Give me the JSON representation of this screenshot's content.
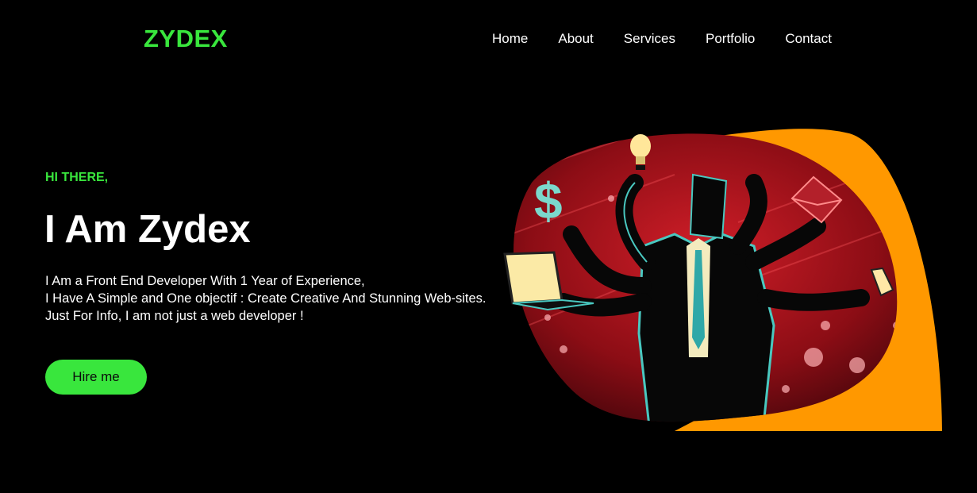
{
  "colors": {
    "accent": "#39e63d",
    "background": "#000000",
    "text": "#ffffff",
    "blob_orange": "#ff9800",
    "scene_red": "#a5121a",
    "scene_dark": "#3a0509",
    "teal": "#49c8c0"
  },
  "header": {
    "logo": "ZYDEX",
    "nav": [
      "Home",
      "About",
      "Services",
      "Portfolio",
      "Contact"
    ]
  },
  "hero": {
    "greeting": "HI THERE,",
    "title": "I Am Zydex",
    "bio": [
      "I Am a Front End Developer With 1 Year of Experience,",
      "I Have A Simple and One objectif : Create Creative And Stunning Web-sites.",
      "Just For Info, I am not just a web developer !"
    ],
    "cta": "Hire me"
  },
  "illustration": {
    "icons": [
      "dollar-icon",
      "lightbulb-icon",
      "envelope-icon",
      "laptop-icon",
      "phone-icon"
    ],
    "dollar_glyph": "$"
  }
}
